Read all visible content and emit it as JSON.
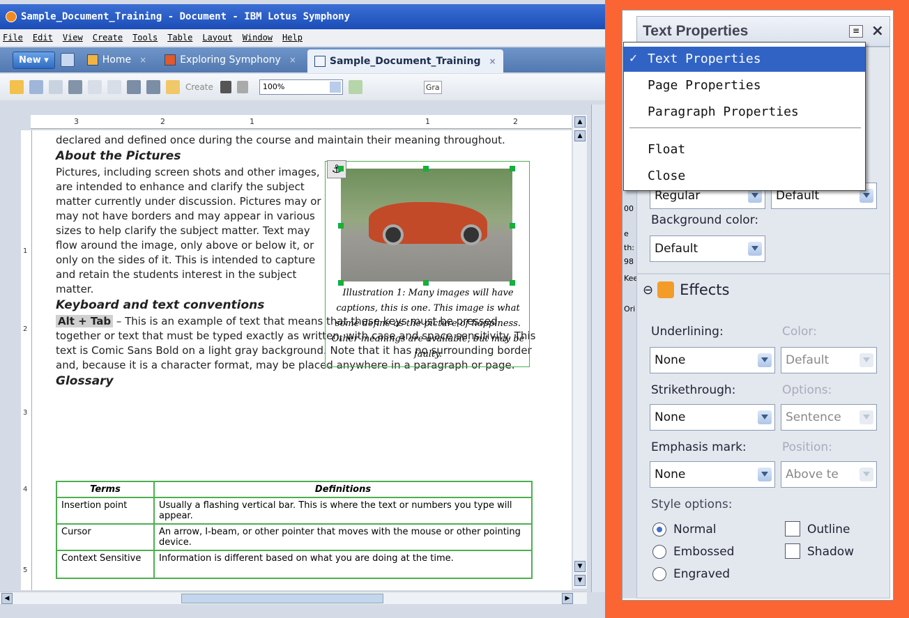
{
  "window": {
    "title": "Sample_Document_Training - Document - IBM Lotus Symphony"
  },
  "menu": [
    "File",
    "Edit",
    "View",
    "Create",
    "Tools",
    "Table",
    "Layout",
    "Window",
    "Help"
  ],
  "tabs": {
    "new_label": "New",
    "items": [
      {
        "label": "Home"
      },
      {
        "label": "Exploring Symphony"
      },
      {
        "label": "Sample_Document_Training"
      }
    ],
    "close_glyph": "×"
  },
  "toolbar": {
    "create_label": "Create",
    "zoom": "100%",
    "style_partial": "Gra"
  },
  "ruler": {
    "h": [
      "3",
      "2",
      "1",
      "1",
      "2"
    ],
    "v": [
      "1",
      "2",
      "3",
      "4",
      "5"
    ]
  },
  "document": {
    "intro": "declared and defined once during the course and maintain their meaning throughout.",
    "h_pictures": "About the Pictures",
    "p_pictures": "Pictures, including screen shots and other images, are intended to enhance and clarify the subject matter currently under discussion. Pictures may or may not have borders and may appear in various sizes to help clarify the subject matter. Text may flow around the image, only above or below it, or only on the sides of it. This is intended to capture and retain the students interest in the subject matter.",
    "caption": "Illustration 1: Many images will have captions, this is one. This image is what some define as the picture of happiness. Other meanings are available, but may be faulty.",
    "h_keyboard": "Keyboard and text conventions",
    "kbd": "Alt + Tab",
    "p_keyboard": " – This is an example of text that means that these keys must be pressed together or text that must be typed exactly as written, with case and space sensitivity. This text is Comic Sans Bold on a light gray background. Note that it has no surrounding border and, because it is a character format, may be placed anywhere in a paragraph or page.",
    "h_glossary": "Glossary",
    "table_headers": [
      "Terms",
      "Definitions"
    ],
    "table_rows": [
      [
        "Insertion point",
        "Usually a flashing vertical bar. This is where the text or numbers you type will appear."
      ],
      [
        "Cursor",
        "An arrow, I-beam, or other pointer that moves with the mouse or other pointing device."
      ],
      [
        "Context Sensitive",
        "Information is different based on what you are doing at the time."
      ]
    ]
  },
  "panel": {
    "title": "Text Properties",
    "close_glyph": "×",
    "style_value": "Regular",
    "size_value": "Default",
    "bg_color_label": "Background color:",
    "bg_color_value": "Default",
    "effects_title": "Effects",
    "underlining_label": "Underlining:",
    "underlining_value": "None",
    "color_label": "Color:",
    "color_value": "Default",
    "strikethrough_label": "Strikethrough:",
    "strikethrough_value": "None",
    "options_label": "Options:",
    "options_value": "Sentence",
    "emphasis_label": "Emphasis mark:",
    "emphasis_value": "None",
    "position_label": "Position:",
    "position_value": "Above te",
    "style_options_label": "Style options:",
    "radio_normal": "Normal",
    "radio_embossed": "Embossed",
    "radio_engraved": "Engraved",
    "chk_outline": "Outline",
    "chk_shadow": "Shadow",
    "left_strip": [
      "00",
      "e",
      "th:",
      "98",
      "Kee",
      "Ori"
    ]
  },
  "popup_menu": {
    "items": [
      "Text Properties",
      "Page Properties",
      "Paragraph Properties",
      "Float",
      "Close"
    ],
    "checked": "✓"
  },
  "colors": {
    "accent": "#3163c5",
    "frame": "#fb6534"
  }
}
